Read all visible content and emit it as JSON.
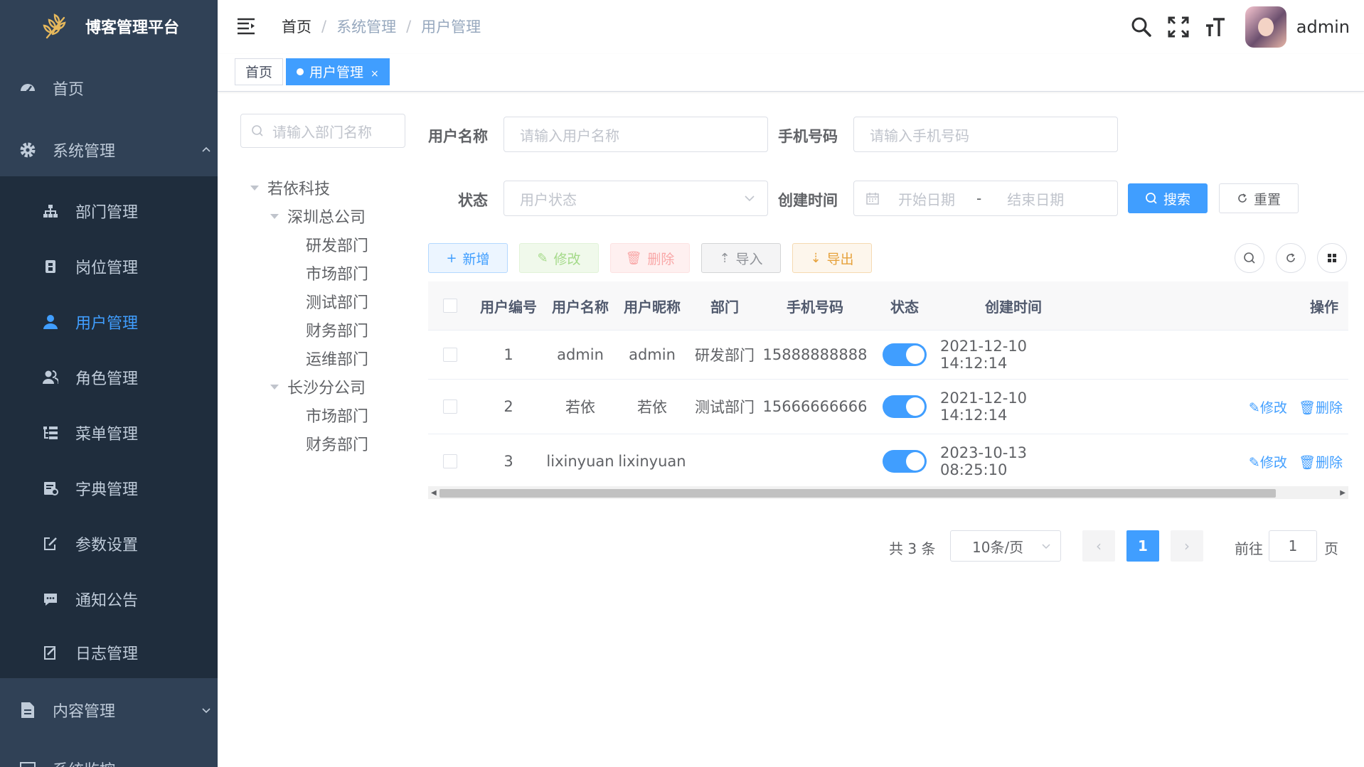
{
  "app": {
    "title": "博客管理平台"
  },
  "sidebar": {
    "home": "首页",
    "system": "系统管理",
    "items": [
      "部门管理",
      "岗位管理",
      "用户管理",
      "角色管理",
      "菜单管理",
      "字典管理",
      "参数设置",
      "通知公告",
      "日志管理"
    ],
    "content": "内容管理",
    "partial": "系统监控"
  },
  "breadcrumb": [
    "首页",
    "系统管理",
    "用户管理"
  ],
  "user": {
    "name": "admin"
  },
  "tags": {
    "home": "首页",
    "active": "用户管理"
  },
  "dept": {
    "placeholder": "请输入部门名称",
    "tree": {
      "root": "若依科技",
      "branch1": "深圳总公司",
      "b1": [
        "研发部门",
        "市场部门",
        "测试部门",
        "财务部门",
        "运维部门"
      ],
      "branch2": "长沙分公司",
      "b2": [
        "市场部门",
        "财务部门"
      ]
    }
  },
  "form": {
    "username_label": "用户名称",
    "username_placeholder": "请输入用户名称",
    "phone_label": "手机号码",
    "phone_placeholder": "请输入手机号码",
    "status_label": "状态",
    "status_placeholder": "用户状态",
    "time_label": "创建时间",
    "start_placeholder": "开始日期",
    "date_sep": "-",
    "end_placeholder": "结束日期",
    "search": "搜索",
    "reset": "重置"
  },
  "toolbar": {
    "add": "新增",
    "edit": "修改",
    "delete": "删除",
    "import": "导入",
    "export": "导出"
  },
  "table": {
    "headers": [
      "用户编号",
      "用户名称",
      "用户昵称",
      "部门",
      "手机号码",
      "状态",
      "创建时间",
      "操作"
    ],
    "rows": [
      {
        "id": "1",
        "name": "admin",
        "nick": "admin",
        "dept": "研发部门",
        "phone": "15888888888",
        "status": true,
        "time": "2021-12-10 14:12:14"
      },
      {
        "id": "2",
        "name": "若依",
        "nick": "若依",
        "dept": "测试部门",
        "phone": "15666666666",
        "status": true,
        "time": "2021-12-10 14:12:14",
        "edit": "修改",
        "del": "删除"
      },
      {
        "id": "3",
        "name": "lixinyuan",
        "nick": "lixinyuan",
        "dept": "",
        "phone": "",
        "status": true,
        "time": "2023-10-13 08:25:10",
        "edit": "修改",
        "del": "删除"
      }
    ]
  },
  "pagination": {
    "total": "共 3 条",
    "size": "10条/页",
    "page": "1",
    "goto": "前往",
    "goto_value": "1",
    "page_suffix": "页"
  },
  "colors": {
    "sidebar": "#304156",
    "submenu": "#1f2d3d",
    "primary": "#409eff"
  }
}
